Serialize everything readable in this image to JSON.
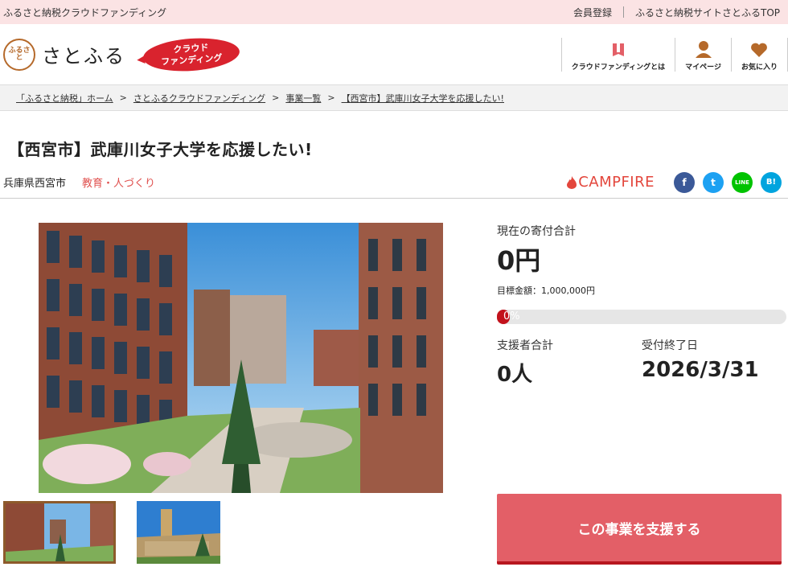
{
  "topbar": {
    "site_name": "ふるさと納税クラウドファンディング",
    "links": [
      "会員登録",
      "ふるさと納税サイトさとふるTOP"
    ]
  },
  "header": {
    "logo_mark": "ふるさと",
    "logo_text": "さとふる",
    "badge": [
      "クラウド",
      "ファンディング"
    ],
    "nav": [
      {
        "label": "クラウドファンディングとは",
        "icon": "book-icon"
      },
      {
        "label": "マイページ",
        "icon": "person-icon"
      },
      {
        "label": "お気に入り",
        "icon": "heart-icon"
      }
    ]
  },
  "breadcrumb": [
    "「ふるさと納税」ホーム",
    "さとふるクラウドファンディング",
    "事業一覧",
    "【西宮市】武庫川女子大学を応援したい!"
  ],
  "breadcrumb_sep": ">",
  "project": {
    "title": "【西宮市】武庫川女子大学を応援したい!",
    "location": "兵庫県西宮市",
    "category": "教育・人づくり"
  },
  "share": {
    "campfire": "CAMPFIRE",
    "buttons": [
      {
        "name": "facebook",
        "glyph": "f",
        "color": "#3b5998"
      },
      {
        "name": "twitter",
        "glyph": "t",
        "color": "#1da1f2"
      },
      {
        "name": "line",
        "glyph": "LINE",
        "color": "#00c300"
      },
      {
        "name": "hatena",
        "glyph": "B!",
        "color": "#00a4de"
      }
    ]
  },
  "stats": {
    "total_label": "現在の寄付合計",
    "total_value": "0円",
    "goal_text": "目標金額：1,000,000円",
    "progress_text": "0%",
    "progress_fraction": 0,
    "supporters_label": "支援者合計",
    "supporters_value": "0人",
    "deadline_label": "受付終了日",
    "deadline_value": "2026/3/31"
  },
  "cta": "この事業を支援する",
  "colors": {
    "accent": "#e35f67",
    "accent_dark": "#b7161f",
    "topbar_bg": "#fbe3e4",
    "category": "#e0514f"
  }
}
